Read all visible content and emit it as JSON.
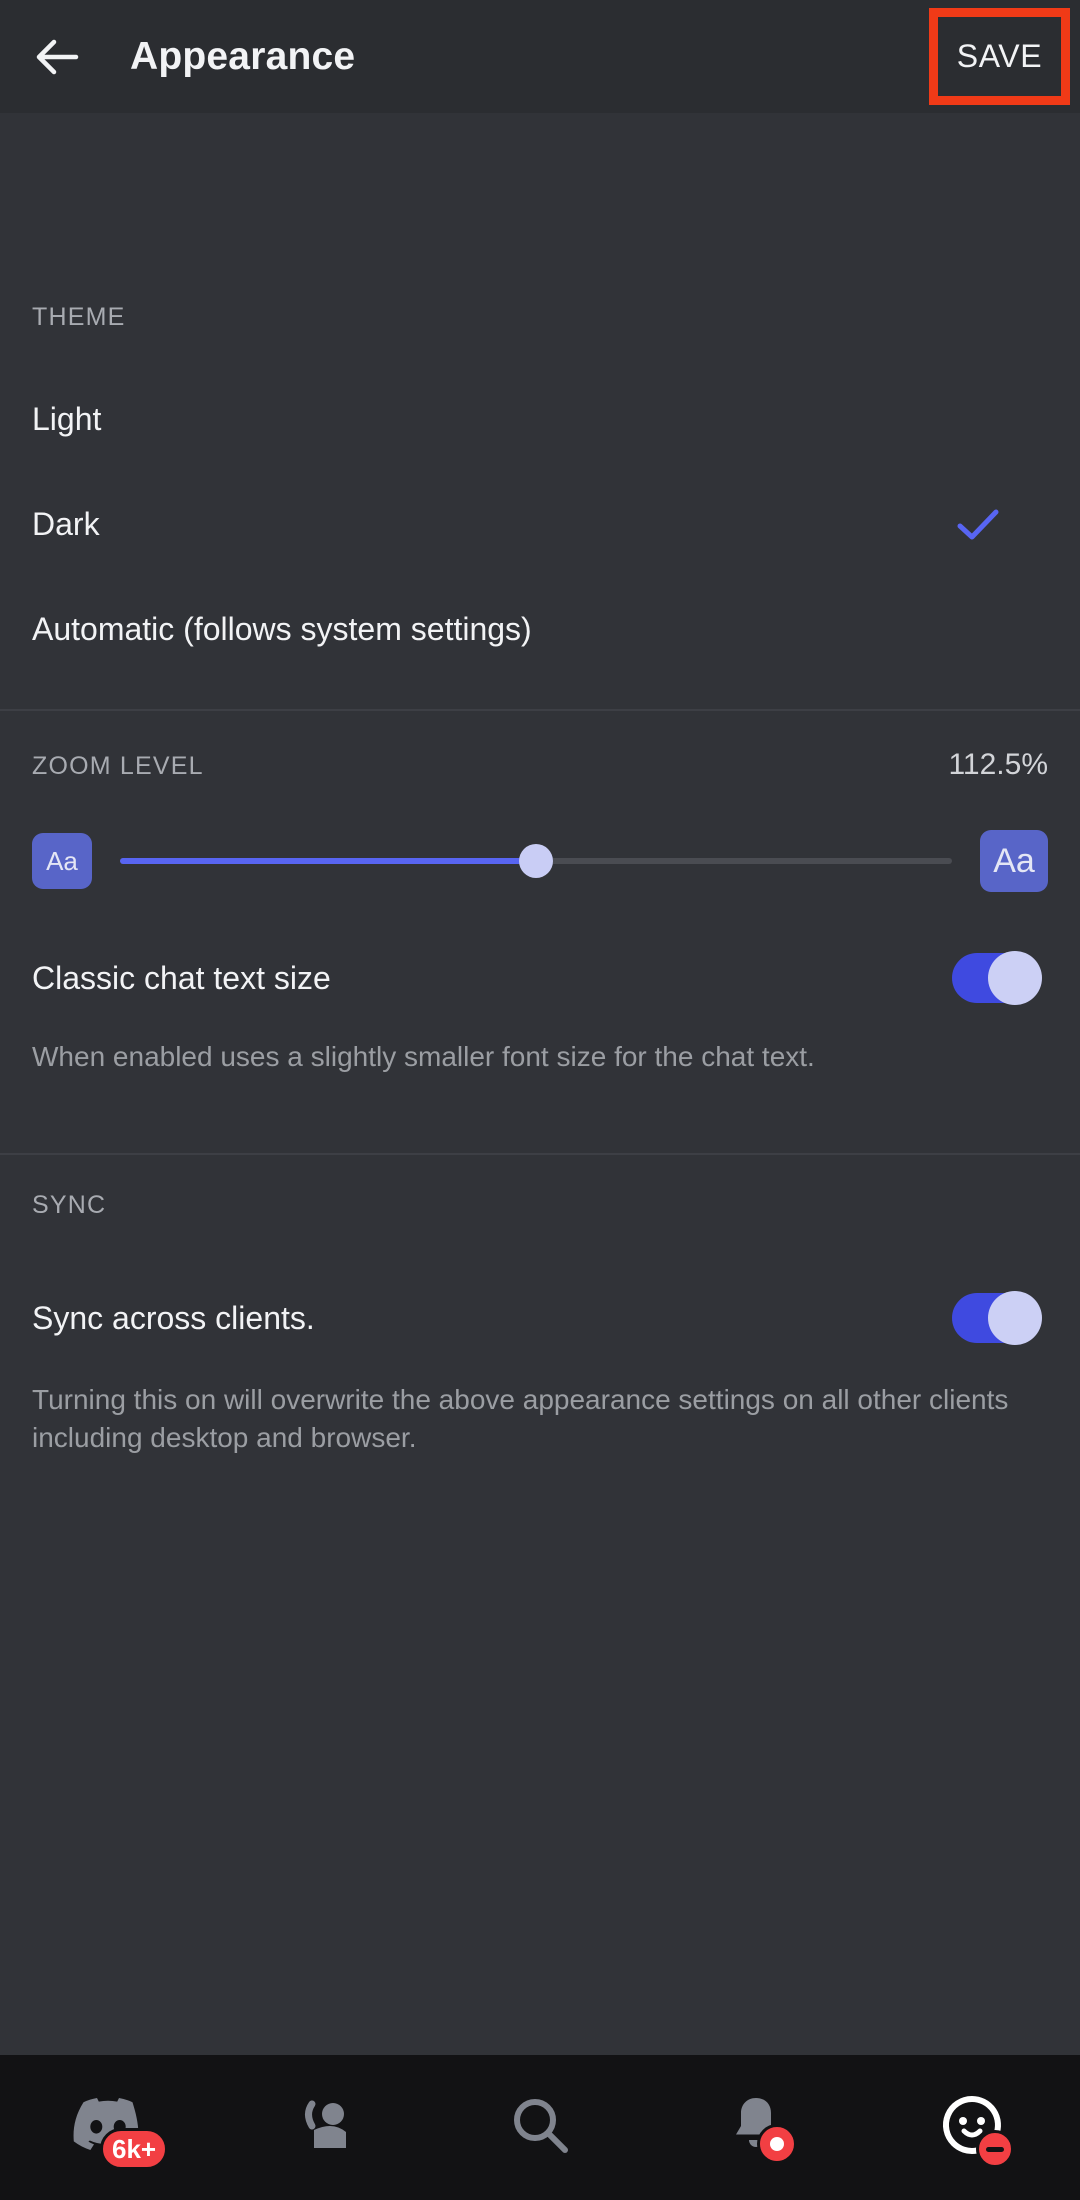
{
  "header": {
    "back_icon": "back-arrow-icon",
    "title": "Appearance",
    "save_label": "SAVE",
    "highlight_color": "#f03a17"
  },
  "theme": {
    "section_label": "THEME",
    "options": [
      {
        "label": "Light",
        "selected": false
      },
      {
        "label": "Dark",
        "selected": true
      },
      {
        "label": "Automatic (follows system settings)",
        "selected": false
      }
    ],
    "check_icon": "check-icon",
    "accent_color": "#5865f2"
  },
  "zoom": {
    "section_label": "ZOOM LEVEL",
    "value": "112.5%",
    "small_label": "Aa",
    "large_label": "Aa",
    "slider_percent": 50
  },
  "classic_text": {
    "label": "Classic chat text size",
    "enabled": true,
    "description": "When enabled uses a slightly smaller font size for the chat text."
  },
  "sync": {
    "section_label": "SYNC",
    "label": "Sync across clients.",
    "enabled": true,
    "description": "Turning this on will overwrite the above appearance settings on all other clients including desktop and browser."
  },
  "navbar": {
    "items": [
      {
        "icon": "discord-servers-icon",
        "badge": "6k+"
      },
      {
        "icon": "friends-icon",
        "badge": ""
      },
      {
        "icon": "search-icon",
        "badge": ""
      },
      {
        "icon": "notifications-bell-icon",
        "badge": "dot"
      },
      {
        "icon": "user-avatar-icon",
        "badge": "dnd"
      }
    ]
  }
}
